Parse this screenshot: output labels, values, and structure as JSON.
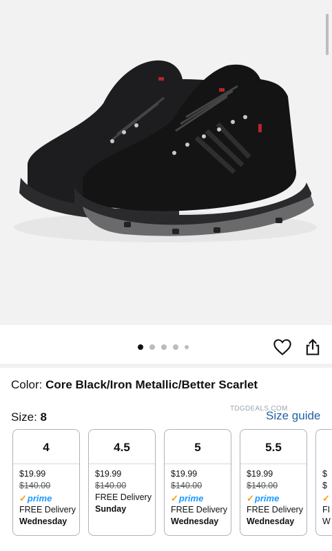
{
  "product_image": {
    "alt": "Core Black golf boot, pair"
  },
  "carousel": {
    "count": 5,
    "active": 0
  },
  "actions": {
    "wishlist_icon": "heart-icon",
    "share_icon": "share-icon"
  },
  "color": {
    "label": "Color: ",
    "value": "Core Black/Iron Metallic/Better Scarlet"
  },
  "size": {
    "label": "Size: ",
    "value": "8",
    "guide_label": "Size guide"
  },
  "watermark": "TDGDEALS.COM",
  "size_options": [
    {
      "size": "4",
      "price": "$19.99",
      "list_price": "$140.00",
      "prime": "prime",
      "delivery": "FREE Delivery",
      "day": "Wednesday"
    },
    {
      "size": "4.5",
      "price": "$19.99",
      "list_price": "$140.00",
      "delivery": "FREE Delivery",
      "day": "Sunday"
    },
    {
      "size": "5",
      "price": "$19.99",
      "list_price": "$140.00",
      "prime": "prime",
      "delivery": "FREE Delivery",
      "day": "Wednesday"
    },
    {
      "size": "5.5",
      "price": "$19.99",
      "list_price": "$140.00",
      "prime": "prime",
      "delivery": "FREE Delivery",
      "day": "Wednesday"
    }
  ],
  "partial_option": {
    "price": "$",
    "list_price": "$",
    "prime_check": "✓",
    "delivery": "FI",
    "day": "W"
  },
  "colors": {
    "link": "#2162a1",
    "prime_blue": "#1a98ff",
    "prime_check": "#ff9900"
  }
}
